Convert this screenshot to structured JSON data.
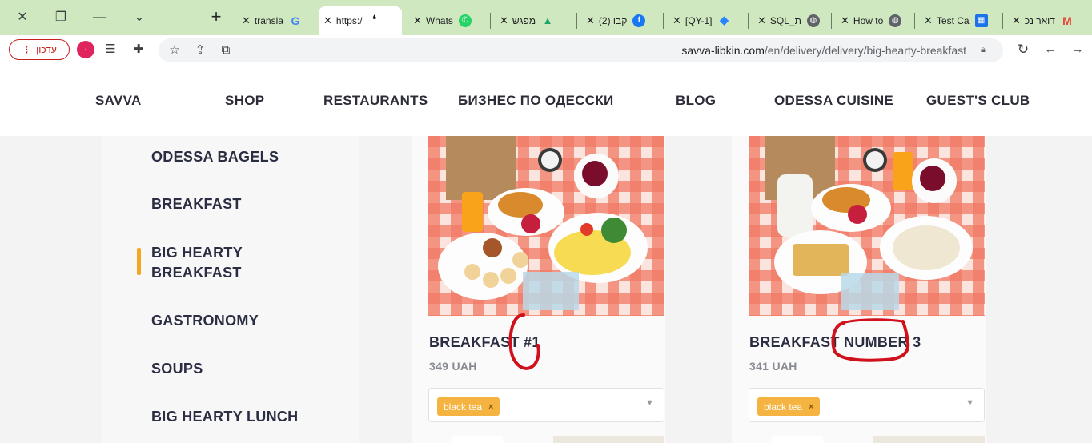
{
  "colors": {
    "tab_strip": "#cfe8c0",
    "accent_marker": "#f5a623",
    "chip": "#f5b342",
    "annotation_red": "#d0101b",
    "heading_text": "#2b2d42"
  },
  "browser": {
    "tabs": [
      {
        "label": "transla",
        "icon": "google-icon",
        "icon_glyph": "G",
        "icon_color": "#4285f4",
        "active": false
      },
      {
        "label": "https:/",
        "icon": "site-logo-icon",
        "icon_glyph": "❛",
        "icon_color": "#000000",
        "active": true
      },
      {
        "label": "Whats",
        "icon": "whatsapp-icon",
        "icon_glyph": "✆",
        "icon_color": "#25d366",
        "active": false
      },
      {
        "label": "מפגש",
        "icon": "google-drive-icon",
        "icon_glyph": "▲",
        "icon_color": "#1fa463",
        "active": false
      },
      {
        "label": "(2) קבו",
        "icon": "facebook-icon",
        "icon_glyph": "f",
        "icon_color": "#1877f2",
        "active": false
      },
      {
        "label": "[QY-1]",
        "icon": "jira-icon",
        "icon_glyph": "◆",
        "icon_color": "#2684ff",
        "active": false
      },
      {
        "label": "SQL_ת",
        "icon": "globe-icon",
        "icon_glyph": "◍",
        "icon_color": "#5f6368",
        "active": false
      },
      {
        "label": "How to",
        "icon": "globe-icon",
        "icon_glyph": "◍",
        "icon_color": "#5f6368",
        "active": false
      },
      {
        "label": "Test Ca",
        "icon": "spreadsheet-icon",
        "icon_glyph": "▦",
        "icon_color": "#1a73e8",
        "active": false
      },
      {
        "label": "דואר נכ",
        "icon": "gmail-icon",
        "icon_glyph": "M",
        "icon_color": "#ea4335",
        "active": false
      }
    ],
    "update_button_label": "עדכון",
    "address": {
      "host": "savva-libkin.com",
      "path": "/en/delivery/delivery/big-hearty-breakfast"
    }
  },
  "site_nav": {
    "items": [
      "SAVVA",
      "SHOP",
      "RESTAURANTS",
      "БИЗНЕС ПО ОДЕССКИ",
      "BLOG",
      "ODESSA CUISINE",
      "GUEST'S CLUB"
    ]
  },
  "sidebar": {
    "categories": [
      "ODESSA BAGELS",
      "BREAKFAST",
      "BIG HEARTY BREAKFAST",
      "GASTRONOMY",
      "SOUPS",
      "BIG HEARTY LUNCH"
    ],
    "selected_index": 2
  },
  "products": [
    {
      "title_prefix": "BREAKFAST ",
      "title_mark": "#1",
      "price": "349 UAH",
      "drink": "black tea",
      "drink_remove": "×"
    },
    {
      "title_prefix": "BREAKFAST ",
      "title_mark": "NUMBER 3",
      "price": "341 UAH",
      "drink": "black tea",
      "drink_remove": "×"
    }
  ]
}
